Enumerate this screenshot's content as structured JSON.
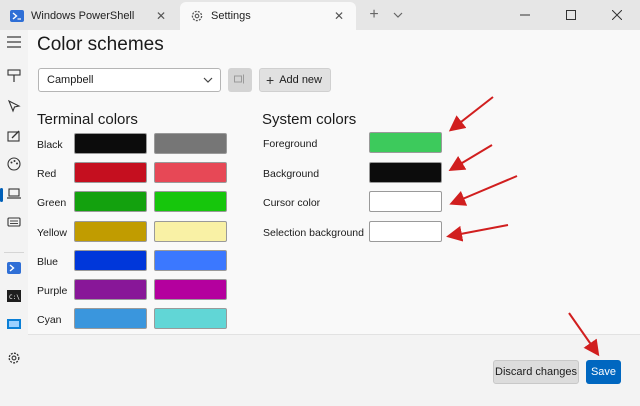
{
  "tabs": [
    {
      "label": "Windows PowerShell",
      "icon": "powershell-icon"
    },
    {
      "label": "Settings",
      "icon": "gear-icon"
    }
  ],
  "page_title": "Color schemes",
  "scheme_select": {
    "value": "Campbell"
  },
  "add_new_label": "Add new",
  "terminal_colors": {
    "title": "Terminal colors",
    "rows": [
      {
        "label": "Black",
        "normal": "#0c0c0c",
        "bright": "#767676"
      },
      {
        "label": "Red",
        "normal": "#c50f1f",
        "bright": "#e74856"
      },
      {
        "label": "Green",
        "normal": "#13a10e",
        "bright": "#16c60c"
      },
      {
        "label": "Yellow",
        "normal": "#c19c00",
        "bright": "#f9f1a5"
      },
      {
        "label": "Blue",
        "normal": "#0037da",
        "bright": "#3b78ff"
      },
      {
        "label": "Purple",
        "normal": "#881798",
        "bright": "#b4009e"
      },
      {
        "label": "Cyan",
        "normal": "#3a96dd",
        "bright": "#61d6d6"
      }
    ]
  },
  "system_colors": {
    "title": "System colors",
    "rows": [
      {
        "label": "Foreground",
        "color": "#3dca5c"
      },
      {
        "label": "Background",
        "color": "#0c0c0c"
      },
      {
        "label": "Cursor color",
        "color": "#ffffff"
      },
      {
        "label": "Selection background",
        "color": "#ffffff"
      }
    ]
  },
  "buttons": {
    "discard": "Discard changes",
    "save": "Save"
  },
  "colors": {
    "accent": "#0067c0",
    "annotation_arrow": "#d11f1f"
  }
}
